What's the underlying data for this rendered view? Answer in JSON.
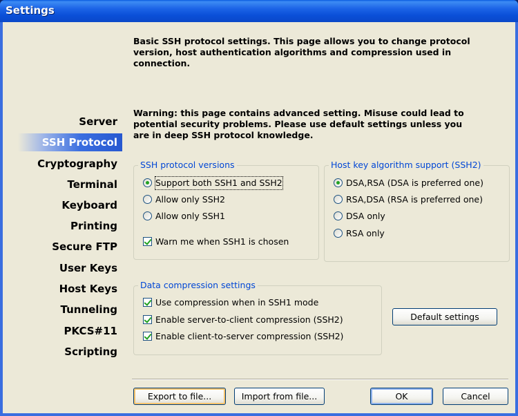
{
  "window": {
    "title": "Settings"
  },
  "sidebar": {
    "items": [
      {
        "label": "Server"
      },
      {
        "label": "SSH Protocol"
      },
      {
        "label": "Cryptography"
      },
      {
        "label": "Terminal"
      },
      {
        "label": "Keyboard"
      },
      {
        "label": "Printing"
      },
      {
        "label": "Secure FTP"
      },
      {
        "label": "User Keys"
      },
      {
        "label": "Host Keys"
      },
      {
        "label": "Tunneling"
      },
      {
        "label": "PKCS#11"
      },
      {
        "label": "Scripting"
      }
    ],
    "selected": "SSH Protocol"
  },
  "description": "Basic SSH protocol settings. This page allows you to change protocol version, host authentication algorithms and compression used in connection.",
  "warning": "Warning: this page contains advanced setting. Misuse could lead to potential security problems. Please use default settings unless you are in deep SSH protocol knowledge.",
  "ssh_versions": {
    "legend": "SSH protocol versions",
    "options": [
      {
        "label": "Support both SSH1 and SSH2",
        "selected": true
      },
      {
        "label": "Allow only SSH2",
        "selected": false
      },
      {
        "label": "Allow only SSH1",
        "selected": false
      }
    ],
    "warn_checkbox": {
      "label": "Warn me when SSH1 is chosen",
      "checked": true
    }
  },
  "host_key": {
    "legend": "Host key algorithm support (SSH2)",
    "options": [
      {
        "label": "DSA,RSA (DSA is preferred one)",
        "selected": true
      },
      {
        "label": "RSA,DSA (RSA is preferred one)",
        "selected": false
      },
      {
        "label": "DSA only",
        "selected": false
      },
      {
        "label": "RSA only",
        "selected": false
      }
    ]
  },
  "compression": {
    "legend": "Data compression settings",
    "options": [
      {
        "label": "Use compression when in SSH1 mode",
        "checked": true
      },
      {
        "label": "Enable server-to-client compression (SSH2)",
        "checked": true
      },
      {
        "label": "Enable client-to-server compression (SSH2)",
        "checked": true
      }
    ]
  },
  "buttons": {
    "default_settings": "Default settings",
    "export": "Export to file...",
    "import": "Import from file...",
    "ok": "OK",
    "cancel": "Cancel"
  },
  "colors": {
    "titlebar": "#0a4fd8",
    "selected_item": "#3a6ee0",
    "legend_text": "#0046d5",
    "check_mark": "#21a121",
    "client_bg": "#ece9d8"
  }
}
